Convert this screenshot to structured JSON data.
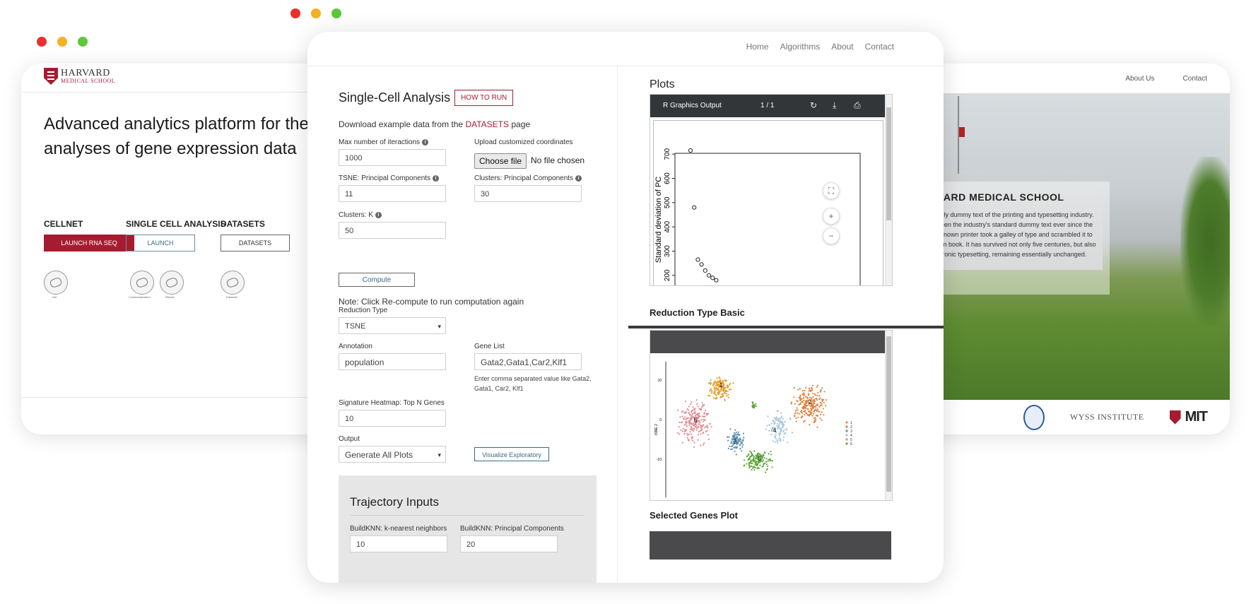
{
  "left_window": {
    "logo": {
      "line1": "HARVARD",
      "line2": "MEDICAL SCHOOL"
    },
    "hero": "Advanced analytics platform for the analyses of gene expression data",
    "sections": [
      {
        "title": "CELLNET",
        "button": "LAUNCH RNA SEQ",
        "captions": [
          "Net"
        ]
      },
      {
        "title": "SINGLE CELL ANALYSIS",
        "button": "LAUNCH",
        "captions": [
          "Contextualization",
          "Rfinder"
        ]
      },
      {
        "title": "DATASETS",
        "button": "DATASETS",
        "captions": [
          "Datasets"
        ]
      }
    ]
  },
  "right_window": {
    "nav": [
      "About Us",
      "Contact"
    ],
    "card_title": "HARVARD MEDICAL SCHOOL",
    "card_text": "Lorem Ipsum is simply dummy text of the printing and typesetting industry. Lorem Ipsum has been the industry's standard dummy text ever since the 1500s, when an unknown printer took a galley of type and scrambled it to make a type specimen book. It has survived not only five centuries, but also the leap into electronic typesetting, remaining essentially unchanged.",
    "logos": {
      "wyss": "WYSS INSTITUTE",
      "mit": "MIT"
    }
  },
  "main_window": {
    "nav": [
      "Home",
      "Algorithms",
      "About",
      "Contact"
    ],
    "title": "Single-Cell Analysis",
    "how_to_run": "HOW TO RUN",
    "download_prefix": "Download example data from the ",
    "download_link": "DATASETS",
    "download_suffix": " page",
    "fields": {
      "max_iter_label": "Max number of iteractions",
      "max_iter_value": "1000",
      "upload_label": "Upload customized coordinates",
      "choose_file": "Choose file",
      "no_file": "No file chosen",
      "tsne_pc_label": "TSNE: Principal Components",
      "tsne_pc_value": "11",
      "clusters_pc_label": "Clusters: Principal Components",
      "clusters_pc_value": "30",
      "clusters_k_label": "Clusters: K",
      "clusters_k_value": "50",
      "compute": "Compute",
      "note": "Note: Click Re-compute to run computation again",
      "reduction_label": "Reduction Type",
      "reduction_value": "TSNE",
      "annotation_label": "Annotation",
      "annotation_value": "population",
      "gene_list_label": "Gene List",
      "gene_list_value": "Gata2,Gata1,Car2,Klf1",
      "gene_hint": "Enter comma separated value like Gata2, Gata1, Car2, Klf1",
      "heatmap_label": "Signature Heatmap: Top N Genes",
      "heatmap_value": "10",
      "output_label": "Output",
      "output_value": "Generate All Plots",
      "visualize": "Visualize Exploratory"
    },
    "trajectory": {
      "title": "Trajectory Inputs",
      "knn_label": "BuildKNN: k-nearest neighbors",
      "knn_value": "10",
      "knn_pc_label": "BuildKNN: Principal Components",
      "knn_pc_value": "20"
    },
    "plots": {
      "title": "Plots",
      "viewer_title": "R Graphics Output",
      "viewer_page": "1 / 1",
      "elbow_ylabel": "Standard deviation of PC",
      "elbow_yticks": [
        "700",
        "600",
        "500",
        "400",
        "300",
        "200"
      ],
      "reduction_heading": "Reduction Type Basic",
      "tsne_ylabel": "tSNE 2",
      "tsne_yticks": [
        "10",
        "0",
        "-10"
      ],
      "cluster_labels": [
        "1",
        "2",
        "3",
        "4",
        "5",
        "6"
      ],
      "cluster_colors": [
        "#e59b24",
        "#e0823f",
        "#5b8fb5",
        "#a7c5dd",
        "#e28a91",
        "#5ea83a"
      ],
      "selected_heading": "Selected Genes Plot"
    }
  },
  "chart_data": [
    {
      "type": "scatter",
      "ylabel": "Standard deviation of PC",
      "ylim": [
        150,
        750
      ],
      "x": [
        1,
        2,
        3,
        4,
        5,
        6,
        7,
        8
      ],
      "y": [
        715,
        480,
        265,
        245,
        220,
        200,
        190,
        180
      ]
    }
  ]
}
